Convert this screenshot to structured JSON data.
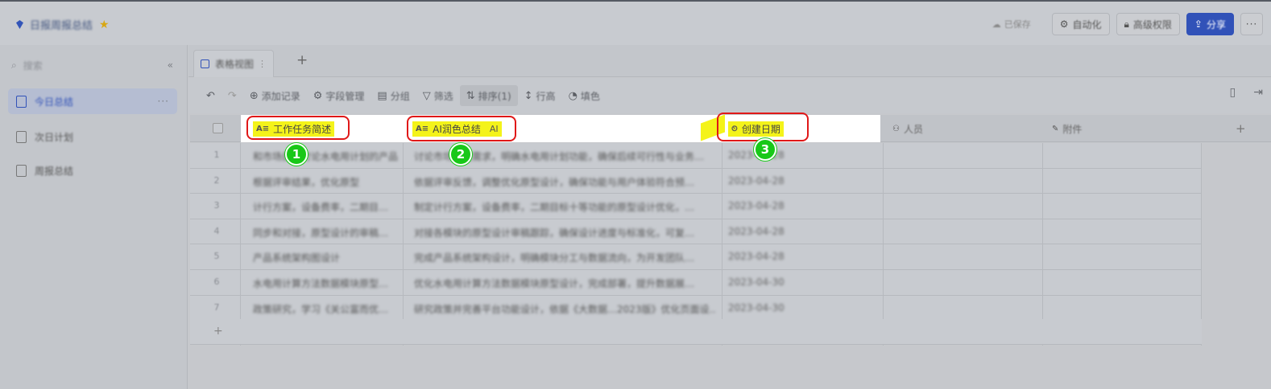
{
  "header": {
    "title": "日报周报总结",
    "saved_text": "已保存",
    "buttons": [
      {
        "label": "自动化"
      },
      {
        "label": "高级权限"
      },
      {
        "label": "分享"
      }
    ],
    "more_label": "···"
  },
  "sidebar": {
    "search_placeholder": "搜索",
    "items": [
      {
        "label": "今日总结",
        "active": true
      },
      {
        "label": "次日计划",
        "active": false
      },
      {
        "label": "周报总结",
        "active": false
      }
    ],
    "more_label": "···"
  },
  "tabs": {
    "view_tab_label": "表格视图",
    "add_label": "+"
  },
  "toolbar": {
    "undo": "↶",
    "redo": "↷",
    "items": [
      {
        "glyph": "⊕",
        "label": "添加记录"
      },
      {
        "glyph": "⚙",
        "label": "字段管理"
      },
      {
        "glyph": "▤",
        "label": "分组"
      },
      {
        "glyph": "▽",
        "label": "筛选"
      },
      {
        "glyph": "⇅",
        "label": "排序(1)"
      },
      {
        "glyph": "↕",
        "label": "行高"
      },
      {
        "glyph": "◔",
        "label": "填色"
      }
    ]
  },
  "table": {
    "columns": [
      {
        "icon": "A≡",
        "label": "工作任务简述"
      },
      {
        "icon": "A≡",
        "label": "AI润色总结",
        "badge": "AI"
      },
      {
        "icon": "⏲",
        "label": "创建日期"
      },
      {
        "icon": "⚇",
        "label": "人员"
      },
      {
        "icon": "✎",
        "label": "附件"
      }
    ],
    "add_column_label": "+",
    "rows": [
      {
        "idx": "1",
        "task": "和市场部门讨论水电用计划的产品…",
        "summary": "讨论市场部门需求，明确水电用计划功能，确保后续可行性与业务…",
        "date": "2023-04-28"
      },
      {
        "idx": "2",
        "task": "根据评审结果，优化原型",
        "summary": "依据评审反馈，调整优化原型设计，确保功能与用户体验符合预…",
        "date": "2023-04-28"
      },
      {
        "idx": "3",
        "task": "计行方案，设备费率，二期目…",
        "summary": "制定计行方案，设备费率，二期目标十等功能的原型设计优化，…",
        "date": "2023-04-28"
      },
      {
        "idx": "4",
        "task": "同步和对接，原型设计的审稿…",
        "summary": "对接各模块的原型设计审稿跟踪，确保设计进度与标准化，可复…",
        "date": "2023-04-28"
      },
      {
        "idx": "5",
        "task": "产品系统架构图设计",
        "summary": "完成产品系统架构设计，明确模块分工与数据流向，为开发团队…",
        "date": "2023-04-28"
      },
      {
        "idx": "6",
        "task": "水电用计算方法数据模块原型…",
        "summary": "优化水电用计算方法数据模块原型设计，完成部署，提升数据展…",
        "date": "2023-04-30"
      },
      {
        "idx": "7",
        "task": "政策研究，学习《关公富而优…",
        "summary": "研究政策并完善平台功能设计，依据《大数据…2023版》优化页面设…",
        "date": "2023-04-30"
      }
    ],
    "add_row_label": "+"
  },
  "annotations": [
    {
      "number": "1",
      "target": "工作任务简述"
    },
    {
      "number": "2",
      "target": "AI润色总结"
    },
    {
      "number": "3",
      "target": "创建日期"
    }
  ],
  "colors": {
    "accent": "#3152b8",
    "highlight": "#f4f31a",
    "annotation_box": "#e01818",
    "annotation_badge": "#18c818"
  }
}
